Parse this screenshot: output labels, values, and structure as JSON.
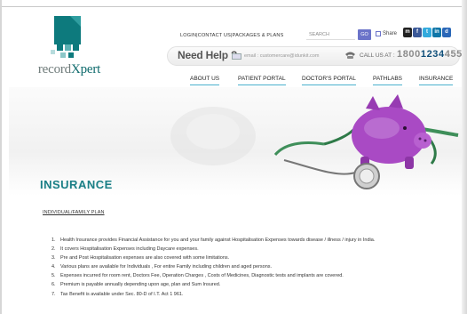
{
  "brand": {
    "logo_prefix": "record",
    "logo_suffix": "Xpert",
    "logo_color": "#0f6b6d"
  },
  "toplinks": {
    "login": "LOGIN",
    "contact": "CONTACT US",
    "packages": "PACKAGES & PLANS",
    "sep": " | "
  },
  "search": {
    "label": "SEARCH",
    "go": "GO",
    "share": "Share"
  },
  "social": [
    {
      "name": "myspace",
      "glyph": "m",
      "color": "#222222"
    },
    {
      "name": "facebook",
      "glyph": "f",
      "color": "#3b5998"
    },
    {
      "name": "twitter",
      "glyph": "t",
      "color": "#33aadd"
    },
    {
      "name": "linkedin",
      "glyph": "in",
      "color": "#0e76a8"
    },
    {
      "name": "delicious",
      "glyph": "d",
      "color": "#2a67b8"
    }
  ],
  "help": {
    "title": "Need Help ?",
    "email_label": "email : customercare@idunkit.com",
    "call_label": "CALL US AT :",
    "phone_a": "1800",
    "phone_b": "1234",
    "phone_c": "455"
  },
  "nav": [
    "ABOUT US",
    "PATIENT PORTAL",
    "DOCTOR'S PORTAL",
    "PATHLABS",
    "INSURANCE"
  ],
  "page": {
    "title": "INSURANCE",
    "subhead": "INDIVIDUAL/FAMILY PLAN",
    "items": [
      "Health Insurance provides Financial Assistance for you and your family against Hospitalisation Expenses towards disease / illness / injury in India.",
      "It covers Hospitalisation Expenses including Daycare expenses.",
      "Pre and Post Hospitalisation expenses are also covered with some limitations.",
      "Various plans are available for Individuals , For entire Family including children and aged persons.",
      "Expenses incurred for room rent, Doctors Fee, Operation Charges , Costs of Medicines, Diagnostic tests and implants are covered.",
      "Premium is payable annually depending upon age, plan and Sum Insured.",
      "Tax Benefit is available under Sec. 80-D of I.T. Act 1 961."
    ]
  }
}
